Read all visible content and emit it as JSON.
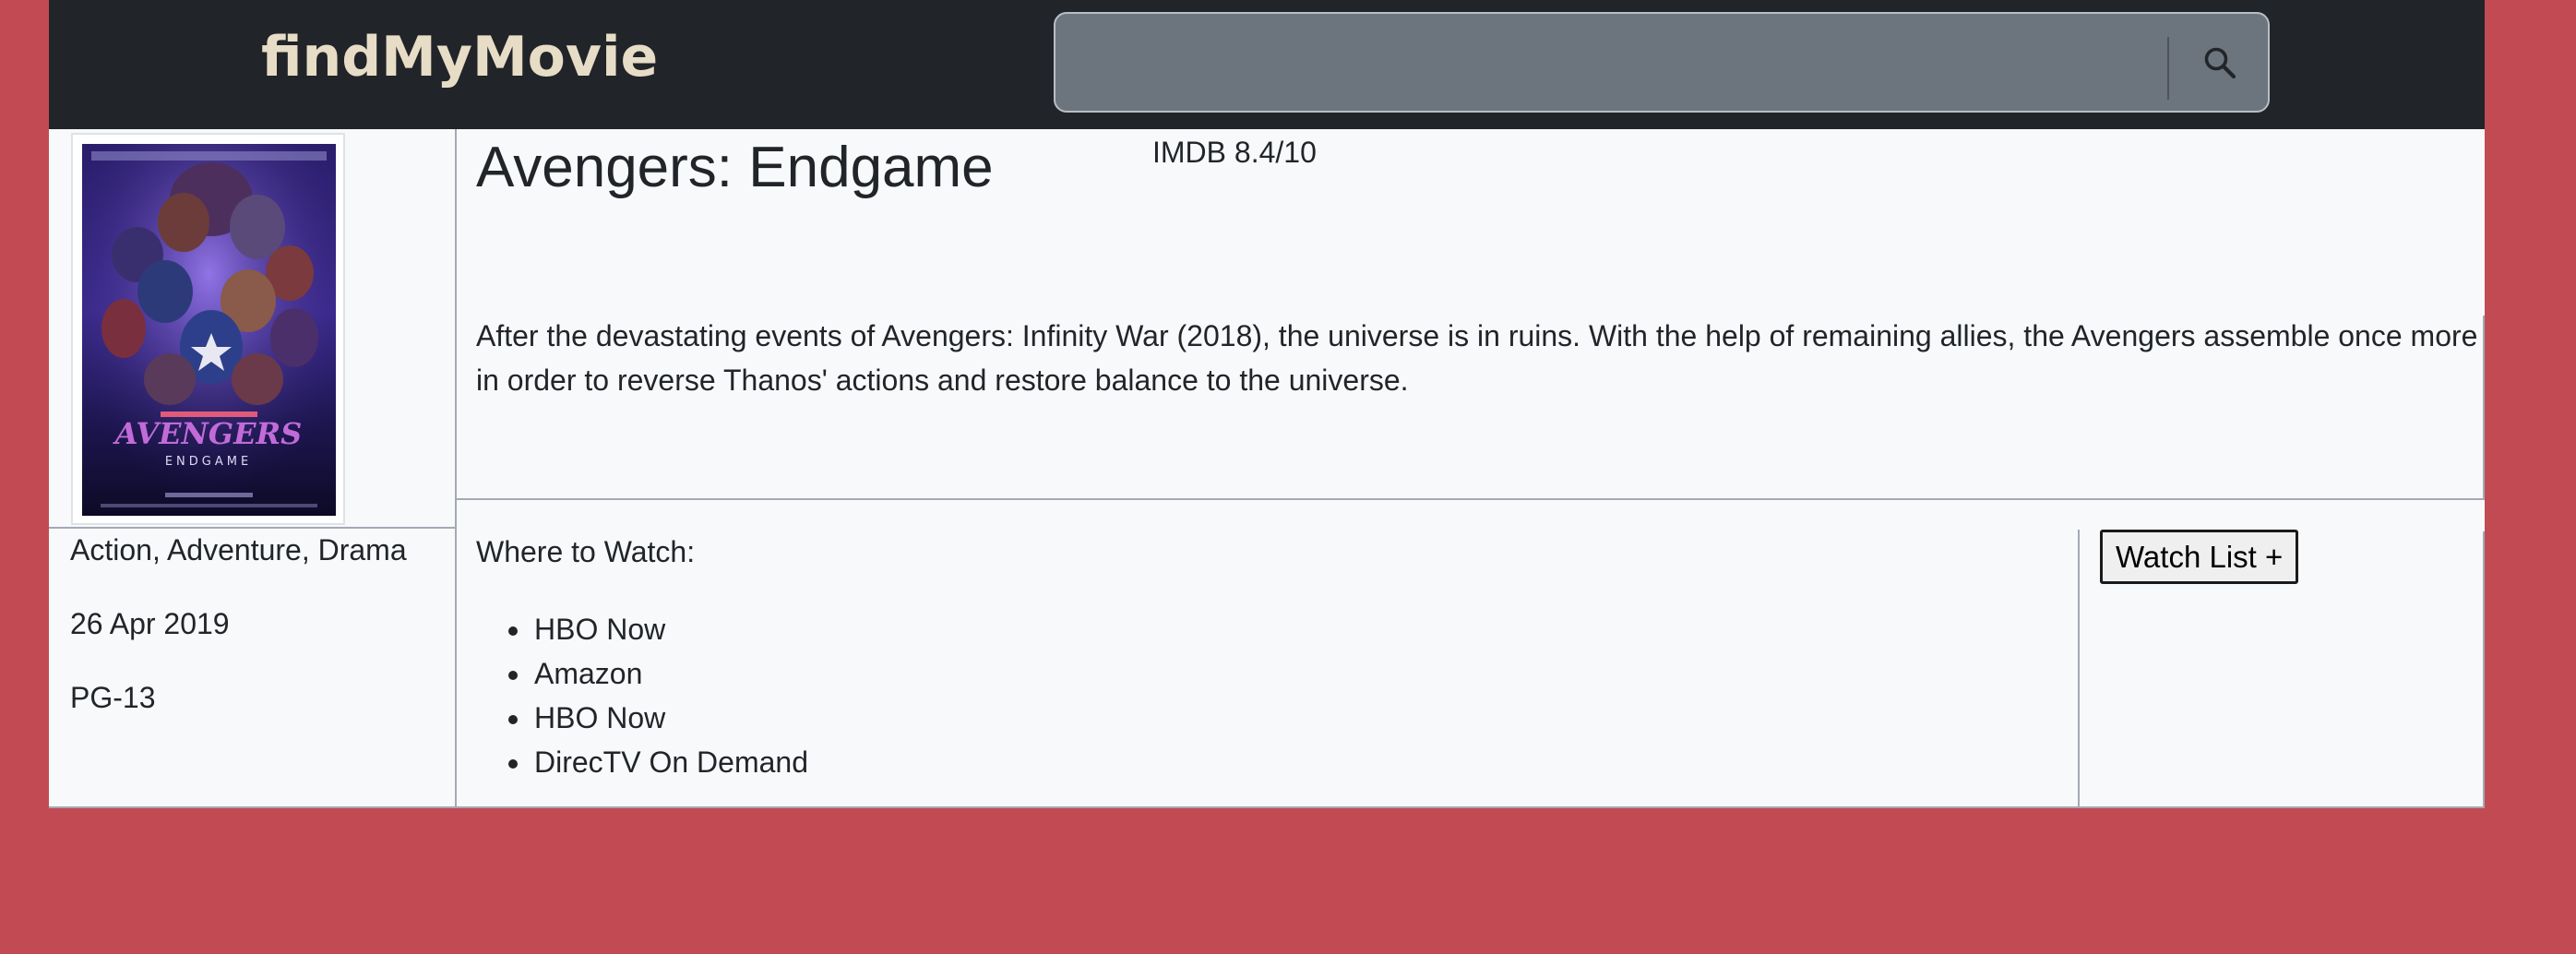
{
  "app": {
    "brand": "findMyMovie"
  },
  "search": {
    "value": "",
    "placeholder": "",
    "icon": "search-icon"
  },
  "movie": {
    "title": "Avengers: Endgame",
    "rating": "IMDB 8.4/10",
    "overview": "After the devastating events of Avengers: Infinity War (2018), the universe is in ruins. With the help of remaining allies, the Avengers assemble once more in order to reverse Thanos' actions and restore balance to the universe.",
    "genres": "Action, Adventure, Drama",
    "release_date": "26 Apr 2019",
    "certification": "PG-13",
    "poster_icon": "movie-poster-image"
  },
  "where_to_watch": {
    "label": "Where to Watch:",
    "providers": [
      "HBO Now",
      "Amazon",
      "HBO Now",
      "DirecTV On Demand"
    ]
  },
  "actions": {
    "watch_list_label": "Watch List +"
  },
  "colors": {
    "page_background": "#c24b53",
    "navbar": "#212428",
    "brand_text": "#e7dcc6",
    "search_field": "#6c757d",
    "content_background": "#f8f9fb",
    "border": "#a3a9b6"
  }
}
